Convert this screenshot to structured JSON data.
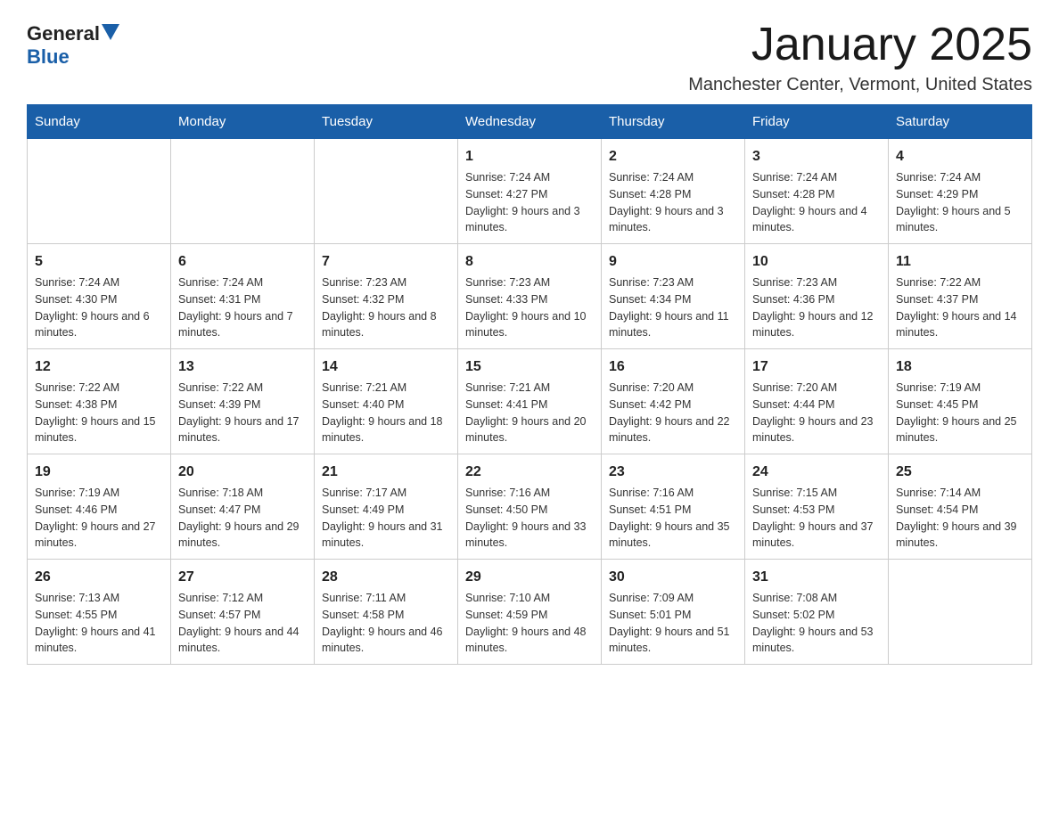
{
  "header": {
    "logo_general": "General",
    "logo_blue": "Blue",
    "month_title": "January 2025",
    "location": "Manchester Center, Vermont, United States"
  },
  "days_of_week": [
    "Sunday",
    "Monday",
    "Tuesday",
    "Wednesday",
    "Thursday",
    "Friday",
    "Saturday"
  ],
  "weeks": [
    [
      {
        "day": "",
        "info": ""
      },
      {
        "day": "",
        "info": ""
      },
      {
        "day": "",
        "info": ""
      },
      {
        "day": "1",
        "info": "Sunrise: 7:24 AM\nSunset: 4:27 PM\nDaylight: 9 hours and 3 minutes."
      },
      {
        "day": "2",
        "info": "Sunrise: 7:24 AM\nSunset: 4:28 PM\nDaylight: 9 hours and 3 minutes."
      },
      {
        "day": "3",
        "info": "Sunrise: 7:24 AM\nSunset: 4:28 PM\nDaylight: 9 hours and 4 minutes."
      },
      {
        "day": "4",
        "info": "Sunrise: 7:24 AM\nSunset: 4:29 PM\nDaylight: 9 hours and 5 minutes."
      }
    ],
    [
      {
        "day": "5",
        "info": "Sunrise: 7:24 AM\nSunset: 4:30 PM\nDaylight: 9 hours and 6 minutes."
      },
      {
        "day": "6",
        "info": "Sunrise: 7:24 AM\nSunset: 4:31 PM\nDaylight: 9 hours and 7 minutes."
      },
      {
        "day": "7",
        "info": "Sunrise: 7:23 AM\nSunset: 4:32 PM\nDaylight: 9 hours and 8 minutes."
      },
      {
        "day": "8",
        "info": "Sunrise: 7:23 AM\nSunset: 4:33 PM\nDaylight: 9 hours and 10 minutes."
      },
      {
        "day": "9",
        "info": "Sunrise: 7:23 AM\nSunset: 4:34 PM\nDaylight: 9 hours and 11 minutes."
      },
      {
        "day": "10",
        "info": "Sunrise: 7:23 AM\nSunset: 4:36 PM\nDaylight: 9 hours and 12 minutes."
      },
      {
        "day": "11",
        "info": "Sunrise: 7:22 AM\nSunset: 4:37 PM\nDaylight: 9 hours and 14 minutes."
      }
    ],
    [
      {
        "day": "12",
        "info": "Sunrise: 7:22 AM\nSunset: 4:38 PM\nDaylight: 9 hours and 15 minutes."
      },
      {
        "day": "13",
        "info": "Sunrise: 7:22 AM\nSunset: 4:39 PM\nDaylight: 9 hours and 17 minutes."
      },
      {
        "day": "14",
        "info": "Sunrise: 7:21 AM\nSunset: 4:40 PM\nDaylight: 9 hours and 18 minutes."
      },
      {
        "day": "15",
        "info": "Sunrise: 7:21 AM\nSunset: 4:41 PM\nDaylight: 9 hours and 20 minutes."
      },
      {
        "day": "16",
        "info": "Sunrise: 7:20 AM\nSunset: 4:42 PM\nDaylight: 9 hours and 22 minutes."
      },
      {
        "day": "17",
        "info": "Sunrise: 7:20 AM\nSunset: 4:44 PM\nDaylight: 9 hours and 23 minutes."
      },
      {
        "day": "18",
        "info": "Sunrise: 7:19 AM\nSunset: 4:45 PM\nDaylight: 9 hours and 25 minutes."
      }
    ],
    [
      {
        "day": "19",
        "info": "Sunrise: 7:19 AM\nSunset: 4:46 PM\nDaylight: 9 hours and 27 minutes."
      },
      {
        "day": "20",
        "info": "Sunrise: 7:18 AM\nSunset: 4:47 PM\nDaylight: 9 hours and 29 minutes."
      },
      {
        "day": "21",
        "info": "Sunrise: 7:17 AM\nSunset: 4:49 PM\nDaylight: 9 hours and 31 minutes."
      },
      {
        "day": "22",
        "info": "Sunrise: 7:16 AM\nSunset: 4:50 PM\nDaylight: 9 hours and 33 minutes."
      },
      {
        "day": "23",
        "info": "Sunrise: 7:16 AM\nSunset: 4:51 PM\nDaylight: 9 hours and 35 minutes."
      },
      {
        "day": "24",
        "info": "Sunrise: 7:15 AM\nSunset: 4:53 PM\nDaylight: 9 hours and 37 minutes."
      },
      {
        "day": "25",
        "info": "Sunrise: 7:14 AM\nSunset: 4:54 PM\nDaylight: 9 hours and 39 minutes."
      }
    ],
    [
      {
        "day": "26",
        "info": "Sunrise: 7:13 AM\nSunset: 4:55 PM\nDaylight: 9 hours and 41 minutes."
      },
      {
        "day": "27",
        "info": "Sunrise: 7:12 AM\nSunset: 4:57 PM\nDaylight: 9 hours and 44 minutes."
      },
      {
        "day": "28",
        "info": "Sunrise: 7:11 AM\nSunset: 4:58 PM\nDaylight: 9 hours and 46 minutes."
      },
      {
        "day": "29",
        "info": "Sunrise: 7:10 AM\nSunset: 4:59 PM\nDaylight: 9 hours and 48 minutes."
      },
      {
        "day": "30",
        "info": "Sunrise: 7:09 AM\nSunset: 5:01 PM\nDaylight: 9 hours and 51 minutes."
      },
      {
        "day": "31",
        "info": "Sunrise: 7:08 AM\nSunset: 5:02 PM\nDaylight: 9 hours and 53 minutes."
      },
      {
        "day": "",
        "info": ""
      }
    ]
  ]
}
